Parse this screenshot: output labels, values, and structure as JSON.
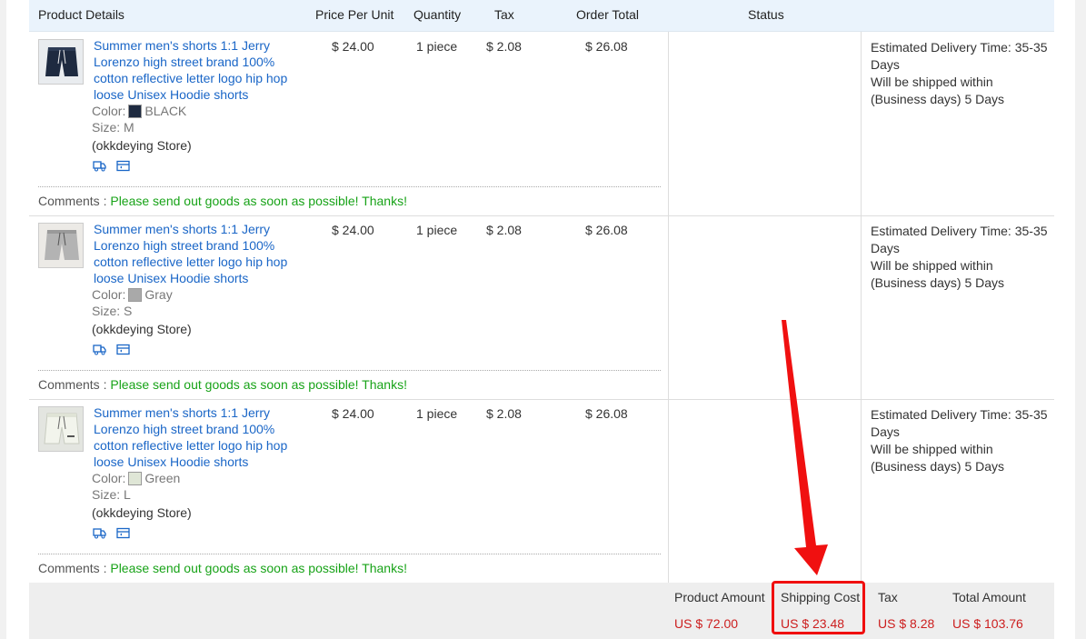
{
  "header": {
    "product_details": "Product Details",
    "price_per_unit": "Price Per Unit",
    "quantity": "Quantity",
    "tax": "Tax",
    "order_total": "Order Total",
    "status": "Status"
  },
  "items": [
    {
      "title": "Summer men's shorts 1:1 Jerry Lorenzo high street brand 100% cotton reflective letter logo hip hop loose Unisex Hoodie shorts",
      "color_label": "Color:",
      "color": "BLACK",
      "swatch_color": "#1e2a40",
      "size_label": "Size:",
      "size": "M",
      "store": "(okkdeying Store)",
      "price": "$ 24.00",
      "quantity": "1 piece",
      "tax": "$ 2.08",
      "total": "$ 26.08",
      "comment_label": "Comments :",
      "comment": "Please send out goods as soon as possible!  Thanks!",
      "status_line1": "Estimated Delivery Time:  35-35 Days",
      "status_line2": "Will be shipped within (Business days) 5 Days"
    },
    {
      "title": "Summer men's shorts 1:1 Jerry Lorenzo high street brand 100% cotton reflective letter logo hip hop loose Unisex Hoodie shorts",
      "color_label": "Color:",
      "color": "Gray",
      "swatch_color": "#a9a9a9",
      "size_label": "Size:",
      "size": "S",
      "store": "(okkdeying Store)",
      "price": "$ 24.00",
      "quantity": "1 piece",
      "tax": "$ 2.08",
      "total": "$ 26.08",
      "comment_label": "Comments :",
      "comment": "Please send out goods as soon as possible!  Thanks!",
      "status_line1": "Estimated Delivery Time:  35-35 Days",
      "status_line2": "Will be shipped within (Business days) 5 Days"
    },
    {
      "title": "Summer men's shorts 1:1 Jerry Lorenzo high street brand 100% cotton reflective letter logo hip hop loose Unisex Hoodie shorts",
      "color_label": "Color:",
      "color": "Green",
      "swatch_color": "#dfe6d6",
      "size_label": "Size:",
      "size": "L",
      "store": "(okkdeying Store)",
      "price": "$ 24.00",
      "quantity": "1 piece",
      "tax": "$ 2.08",
      "total": "$ 26.08",
      "comment_label": "Comments :",
      "comment": "Please send out goods as soon as possible!  Thanks!",
      "status_line1": "Estimated Delivery Time:  35-35 Days",
      "status_line2": "Will be shipped within (Business days) 5 Days"
    }
  ],
  "summary": {
    "product_amount_label": "Product Amount",
    "product_amount": "US $ 72.00",
    "shipping_cost_label": "Shipping Cost",
    "shipping_cost": "US $ 23.48",
    "tax_label": "Tax",
    "tax": "US $ 8.28",
    "total_amount_label": "Total Amount",
    "total_amount": "US $ 103.76"
  },
  "colors": {
    "link": "#1a66c7",
    "comment_text": "#18a318",
    "price_red": "#cc1e1e",
    "highlight_red": "#f00f0f",
    "header_bg": "#eaf3fc"
  },
  "icons": [
    "shipping-truck-icon",
    "shipping-card-icon",
    "pointer-arrow-icon"
  ]
}
